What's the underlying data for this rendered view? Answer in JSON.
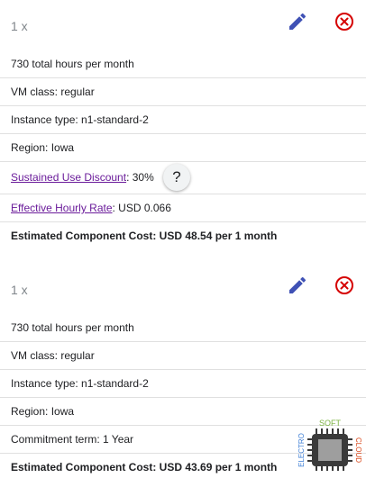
{
  "colors": {
    "edit": "#3f51b5",
    "delete": "#d50000",
    "link": "#6a1b9a"
  },
  "items": [
    {
      "quantity": "1 x",
      "hours": "730 total hours per month",
      "vm_class": "VM class: regular",
      "instance_type": "Instance type: n1-standard-2",
      "region": "Region: Iowa",
      "discount_label": "Sustained Use Discount",
      "discount_value": ": 30%",
      "help_label": "?",
      "rate_label": "Effective Hourly Rate",
      "rate_value": ": USD 0.066",
      "cost": "Estimated Component Cost: USD 48.54 per 1 month",
      "edit_icon": "pencil-icon",
      "delete_icon": "cancel-icon"
    },
    {
      "quantity": "1 x",
      "hours": "730 total hours per month",
      "vm_class": "VM class: regular",
      "instance_type": "Instance type: n1-standard-2",
      "region": "Region: Iowa",
      "commitment": "Commitment term: 1 Year",
      "cost": "Estimated Component Cost: USD 43.69 per 1 month",
      "edit_icon": "pencil-icon",
      "delete_icon": "cancel-icon"
    }
  ],
  "watermark": {
    "top": "SOFT",
    "left": "ELECTRO",
    "right": "CLOUD"
  }
}
